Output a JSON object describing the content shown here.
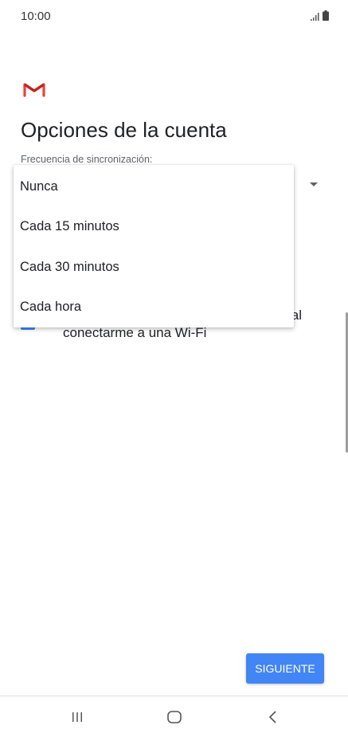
{
  "status_bar": {
    "time": "10:00",
    "icons": [
      "signal-icon",
      "battery-icon"
    ]
  },
  "header": {
    "logo_icon": "gmail-logo-icon",
    "title": "Opciones de la cuenta"
  },
  "sync": {
    "label": "Frecuencia de sincronización:",
    "options": [
      "Nunca",
      "Cada 15 minutos",
      "Cada 30 minutos",
      "Cada hora"
    ]
  },
  "wifi_option": {
    "checked": true,
    "line1_visible": "al",
    "line2": "conectarme a una Wi-Fi"
  },
  "footer": {
    "next_label": "SIGUIENTE"
  },
  "nav": {
    "icons": [
      "recent-apps-icon",
      "home-icon",
      "back-icon"
    ]
  },
  "colors": {
    "accent": "#4285f4",
    "gmail_red": "#ea4335"
  }
}
